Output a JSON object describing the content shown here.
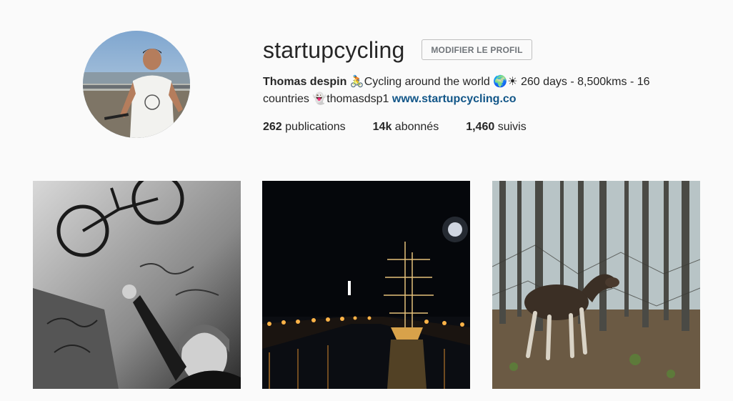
{
  "profile": {
    "username": "startupcycling",
    "edit_button": "MODIFIER LE PROFIL",
    "full_name": "Thomas despin",
    "bio_line1": "🚴Cycling around the world 🌍☀ 260 days - 8,500kms - 16",
    "bio_line2": "countries 👻thomasdsp1 ",
    "website": "www.startupcycling.co"
  },
  "stats": {
    "posts_count": "262",
    "posts_label": " publications",
    "followers_count": "14k",
    "followers_label": " abonnés",
    "following_count": "1,460",
    "following_label": " suivis"
  },
  "posts": [
    {
      "subject": "black-and-white photo of a man pointing at a graffiti wall with a bicycle hanging overhead"
    },
    {
      "subject": "night photo of an illuminated tall ship in a canal"
    },
    {
      "subject": "moose standing among bare trees in a forest"
    }
  ],
  "colors": {
    "background": "#fafafa",
    "link": "#125688",
    "text": "#262626",
    "button_border": "#bfbfbf"
  }
}
